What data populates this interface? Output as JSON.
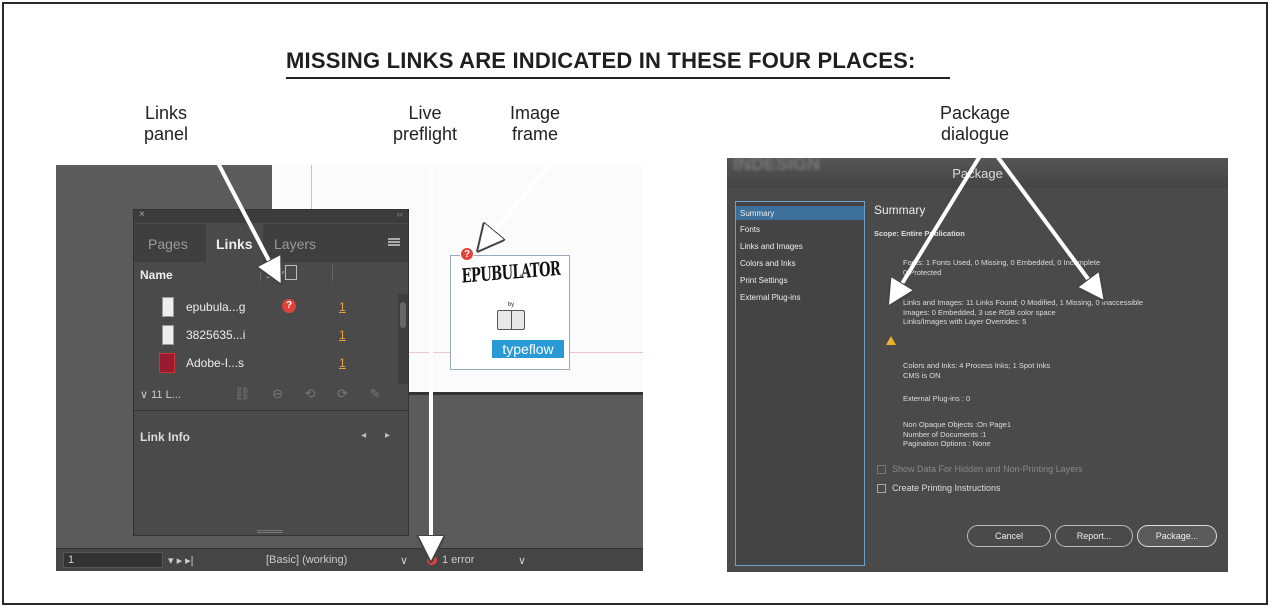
{
  "headline": "MISSING LINKS ARE INDICATED IN THESE FOUR PLACES:",
  "callouts": {
    "links_panel": "Links\npanel",
    "live_preflight": "Live\npreflight",
    "image_frame": "Image\nframe",
    "package_dialogue": "Package\ndialogue"
  },
  "links_panel": {
    "close": "×",
    "collapse": "‹‹",
    "tabs": [
      {
        "label": "Pages",
        "active": false
      },
      {
        "label": "Links",
        "active": true
      },
      {
        "label": "Layers",
        "active": false
      }
    ],
    "column_name": "Name",
    "column_warn": "⚠▾",
    "rows": [
      {
        "name": "epubula...g",
        "status": "missing",
        "page": "1"
      },
      {
        "name": "3825635...i",
        "status": "ok",
        "page": "1"
      },
      {
        "name": "Adobe-I...s",
        "status": "ok",
        "page": "1"
      }
    ],
    "error_glyph": "?",
    "count_label": "∨  11 L...",
    "tool_icons": "⛓ ⊖ ⟲ ⟳ ✎",
    "link_info_label": "Link Info",
    "link_info_nav": "◂ ▸"
  },
  "status_bar": {
    "page_field": "1",
    "nav": "▾  ▸  ▸|",
    "profile": "[Basic] (working)",
    "profile_arrow": "∨",
    "error_text": "1 error",
    "error_arrow": "∨"
  },
  "image_frame": {
    "logo_title": "EPUBULATOR",
    "logo_by": "by",
    "logo_brand": "typeflow",
    "error_glyph": "?"
  },
  "package_dialog": {
    "title": "Package",
    "bg_title": "INDESIGN",
    "sidebar": [
      "Summary",
      "Fonts",
      "Links and Images",
      "Colors and Inks",
      "Print Settings",
      "External Plug-ins"
    ],
    "selected_index": 0,
    "heading": "Summary",
    "scope": "Scope:   Entire Publication",
    "fonts": "Fonts: 1 Fonts Used, 0 Missing, 0 Embedded, 0 Incomplete\n0 Protected",
    "links": "Links and Images: 11 Links Found; 0 Modified, 1 Missing, 0 Inaccessible\nImages: 0 Embedded, 3 use RGB color space\nLinks/Images with Layer Overrides: 5",
    "colors": "Colors and Inks: 4 Process Inks; 1 Spot Inks\nCMS is ON",
    "plugins": "External Plug-ins : 0",
    "non_opaque": "Non Opaque Objects :On Page1\nNumber of Documents :1\nPagination Options : None",
    "show_data": "Show Data For Hidden and Non-Printing Layers",
    "create_instructions": "Create Printing Instructions",
    "buttons": {
      "cancel": "Cancel",
      "report": "Report...",
      "package": "Package..."
    }
  },
  "colors": {
    "error_red": "#e0413a",
    "warning_yellow": "#e9b227",
    "selection_blue": "#3d6f9b",
    "link_page_orange": "#e6a43a"
  }
}
